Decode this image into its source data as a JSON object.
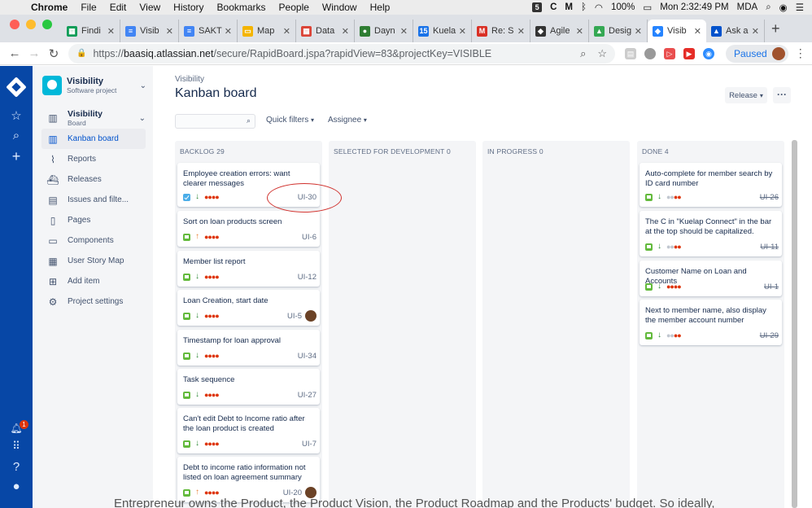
{
  "macmenu": {
    "app": "Chrome",
    "items": [
      "File",
      "Edit",
      "View",
      "History",
      "Bookmarks",
      "People",
      "Window",
      "Help"
    ],
    "battery": "100%",
    "clock": "Mon 2:32:49 PM",
    "user": "MDA"
  },
  "tabs": [
    {
      "title": "Findi",
      "color": "#0f9d58",
      "glyph": "▦"
    },
    {
      "title": "Visib",
      "color": "#4285f4",
      "glyph": "≡"
    },
    {
      "title": "SAKT",
      "color": "#4285f4",
      "glyph": "≡"
    },
    {
      "title": "Map",
      "color": "#f4b400",
      "glyph": "▭"
    },
    {
      "title": "Data",
      "color": "#db4437",
      "glyph": "▦"
    },
    {
      "title": "Dayn",
      "color": "#2e7d32",
      "glyph": "●"
    },
    {
      "title": "Kuela",
      "color": "#1a73e8",
      "glyph": "15"
    },
    {
      "title": "Re: S",
      "color": "#d93025",
      "glyph": "M"
    },
    {
      "title": "Agile",
      "color": "#333333",
      "glyph": "◆"
    },
    {
      "title": "Desig",
      "color": "#34a853",
      "glyph": "▲"
    },
    {
      "title": "Visib",
      "color": "#2684ff",
      "glyph": "◆",
      "active": true
    },
    {
      "title": "Ask a",
      "color": "#0052cc",
      "glyph": "▲"
    }
  ],
  "address": {
    "prefix": "https://",
    "host": "baasiq.atlassian.net",
    "path": "/secure/RapidBoard.jspa?rapidView=83&projectKey=VISIBLE"
  },
  "profile": {
    "label": "Paused"
  },
  "sidebar": {
    "project_name": "Visibility",
    "project_type": "Software project",
    "board_name": "Visibility",
    "board_sub": "Board",
    "items": [
      {
        "label": "Kanban board",
        "icon": "▥",
        "active": true
      },
      {
        "label": "Reports",
        "icon": "⌇"
      },
      {
        "label": "Releases",
        "icon": "⛴"
      },
      {
        "label": "Issues and filte...",
        "icon": "▤"
      },
      {
        "label": "Pages",
        "icon": "▯"
      },
      {
        "label": "Components",
        "icon": "▭"
      },
      {
        "label": "User Story Map",
        "icon": "▦"
      },
      {
        "label": "Add item",
        "icon": "⊞"
      },
      {
        "label": "Project settings",
        "icon": "⚙"
      }
    ]
  },
  "notifications_count": "1",
  "header": {
    "breadcrumb": "Visibility",
    "title": "Kanban board",
    "release_label": "Release",
    "more_label": "···",
    "quick_filters": "Quick filters",
    "assignee": "Assignee"
  },
  "columns": [
    {
      "name": "BACKLOG",
      "count": "29",
      "cards": [
        {
          "title": "Employee creation errors: want clearer messages",
          "type": "task",
          "priority": "low",
          "key": "UI-30",
          "est": "mixed-red"
        },
        {
          "title": "Sort on loan products screen",
          "type": "story",
          "priority": "high",
          "key": "UI-6",
          "est": "red"
        },
        {
          "title": "Member list report",
          "type": "story",
          "priority": "low",
          "key": "UI-12",
          "est": "red"
        },
        {
          "title": "Loan Creation, start date",
          "type": "story",
          "priority": "low",
          "key": "UI-5",
          "est": "red",
          "avatar": true
        },
        {
          "title": "Timestamp for loan approval",
          "type": "story",
          "priority": "low",
          "key": "UI-34",
          "est": "red"
        },
        {
          "title": "Task sequence",
          "type": "story",
          "priority": "low",
          "key": "UI-27",
          "est": "red"
        },
        {
          "title": "Can't edit Debt to Income ratio after the loan product is created",
          "type": "story",
          "priority": "low",
          "key": "UI-7",
          "est": "red"
        },
        {
          "title": "Debt to income ratio information not listed on loan agreement summary",
          "type": "story",
          "priority": "high",
          "key": "UI-20",
          "est": "red",
          "avatar": true
        }
      ]
    },
    {
      "name": "SELECTED FOR DEVELOPMENT",
      "count": "0",
      "cards": []
    },
    {
      "name": "IN PROGRESS",
      "count": "0",
      "cards": []
    },
    {
      "name": "DONE",
      "count": "4",
      "cards": [
        {
          "title": "Auto-complete for member search by ID card number",
          "type": "story",
          "priority": "low",
          "key": "UI-26",
          "est": "mixed",
          "done": true
        },
        {
          "title": "The C in \"Kuelap Connect\" in the bar at the top should be capitalized.",
          "type": "story",
          "priority": "low",
          "key": "UI-11",
          "est": "mixed",
          "done": true
        },
        {
          "title": "Customer Name on Loan and Accounts",
          "type": "story",
          "priority": "low",
          "key": "UI-1",
          "est": "red",
          "done": true
        },
        {
          "title": "Next to member name, also display the member account number",
          "type": "story",
          "priority": "low",
          "key": "UI-29",
          "est": "mixed",
          "done": true
        }
      ]
    }
  ],
  "bleed_text": "Entrepreneur owns the Product, the Product Vision, the Product Roadmap and the Products' budget. So ideally,"
}
